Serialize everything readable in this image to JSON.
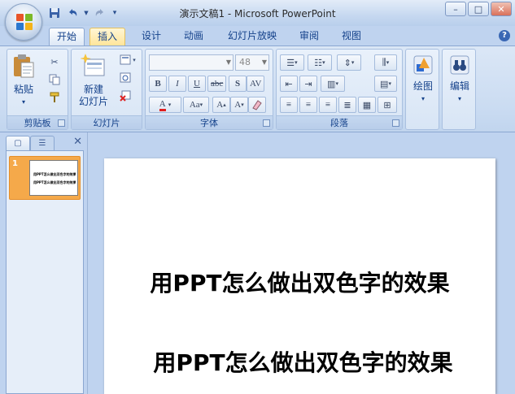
{
  "window": {
    "title": "演示文稿1 - Microsoft PowerPoint",
    "controls": [
      "–",
      "□",
      "✕"
    ]
  },
  "quick_access": {
    "save_icon": "save-icon",
    "undo_icon": "undo-icon",
    "redo_icon": "redo-icon"
  },
  "tabs": [
    {
      "label": "开始",
      "state": "active"
    },
    {
      "label": "插入",
      "state": "hover"
    },
    {
      "label": "设计",
      "state": "normal"
    },
    {
      "label": "动画",
      "state": "normal"
    },
    {
      "label": "幻灯片放映",
      "state": "normal"
    },
    {
      "label": "审阅",
      "state": "normal"
    },
    {
      "label": "视图",
      "state": "normal"
    }
  ],
  "ribbon": {
    "clipboard": {
      "label": "剪贴板",
      "paste_label": "粘贴"
    },
    "slides": {
      "label": "幻灯片",
      "new_slide_line1": "新建",
      "new_slide_line2": "幻灯片"
    },
    "font": {
      "label": "字体",
      "font_size": "48",
      "font_name": ""
    },
    "paragraph": {
      "label": "段落"
    },
    "drawing": {
      "label": "绘图"
    },
    "editing": {
      "label": "编辑"
    }
  },
  "slides_pane": {
    "slides": [
      {
        "number": "1",
        "lines": [
          "用PPT怎么做出双色字的效果",
          "用PPT怎么做出双色字的效果"
        ]
      }
    ]
  },
  "current_slide": {
    "line1": "用PPT怎么做出双色字的效果",
    "line2": "用PPT怎么做出双色字的效果"
  },
  "colors": {
    "ribbon_bg": "#cbdcf2",
    "accent_text": "#15428b",
    "selected_slide": "#f5a94a"
  }
}
